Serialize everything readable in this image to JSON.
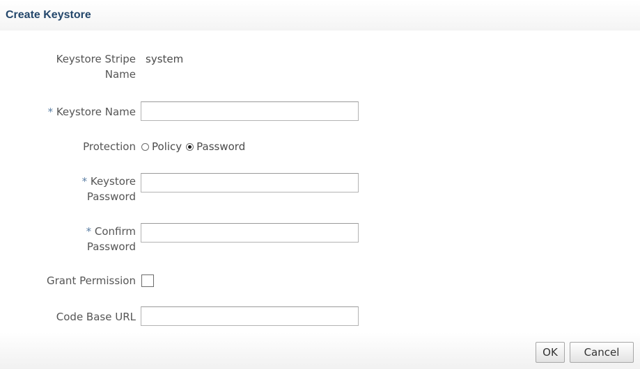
{
  "header": {
    "title": "Create Keystore"
  },
  "form": {
    "stripe_label_line1": "Keystore Stripe",
    "stripe_label_line2": "Name",
    "stripe_value": "system",
    "required_marker": "*",
    "keystore_name_label": "Keystore Name",
    "keystore_name_value": "",
    "protection_label": "Protection",
    "protection_options": [
      "Policy",
      "Password"
    ],
    "protection_selected": "Password",
    "keystore_password_label_line1": "Keystore",
    "keystore_password_label_line2": "Password",
    "keystore_password_value": "",
    "confirm_password_label_line1": "Confirm",
    "confirm_password_label_line2": "Password",
    "confirm_password_value": "",
    "grant_permission_label": "Grant Permission",
    "grant_permission_checked": false,
    "code_base_url_label": "Code Base URL",
    "code_base_url_value": ""
  },
  "footer": {
    "ok_label": "OK",
    "cancel_label": "Cancel"
  },
  "colors": {
    "title": "#24476b",
    "required": "#5b7ea3",
    "label": "#555555"
  }
}
